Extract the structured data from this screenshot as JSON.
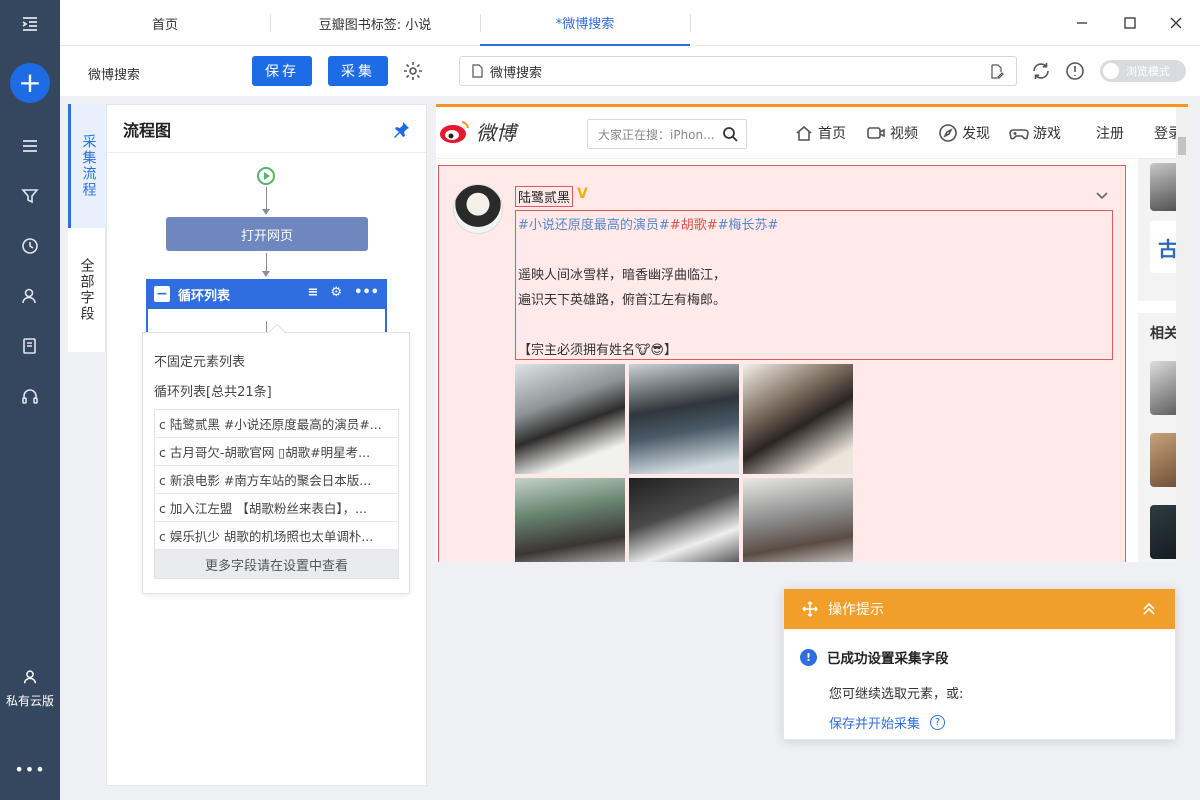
{
  "tabs": [
    {
      "label": "首页",
      "active": false
    },
    {
      "label": "豆瓣图书标签: 小说",
      "active": false
    },
    {
      "label": "*微博搜索",
      "active": true
    }
  ],
  "rail": {
    "cloud_label": "私有云版",
    "more_label": "•••"
  },
  "toolbar": {
    "title": "微博搜索",
    "save_label": "保存",
    "collect_label": "采集",
    "url_value": "微博搜索",
    "browse_mode_label": "浏览模式"
  },
  "side_tabs": {
    "collect_flow": "采集流程",
    "all_fields": "全部字段"
  },
  "flow": {
    "title": "流程图",
    "open_page_label": "打开网页",
    "loop_label": "循环列表",
    "tools": [
      "≡",
      "⚙",
      "•••"
    ]
  },
  "popover": {
    "type_label": "不固定元素列表",
    "count_label": "循环列表[总共21条]",
    "rows": [
      "c 陆鹭贰黑 #小说还原度最高的演员#...",
      "c 古月哥欠-胡歌官网 ▯胡歌#明星考...",
      "c 新浪电影 #南方车站的聚会日本版...",
      "c 加入江左盟 【胡歌粉丝来表白】，...",
      "c 娱乐扒少 胡歌的机场照也太单调朴..."
    ],
    "more_label": "更多字段请在设置中查看"
  },
  "weibo": {
    "logo_text": "微博",
    "search_placeholder": "大家正在搜：iPhon...",
    "nav": [
      "首页",
      "视频",
      "发现",
      "游戏",
      "注册",
      "登录"
    ],
    "post": {
      "author": "陆鹭贰黑",
      "topic_1": "#小说还原度最高的演员#",
      "topic_2": "#胡歌#",
      "topic_3": "#梅长苏#",
      "line_1": "遥映人间冰雪样，暗香幽浮曲临江，",
      "line_2": "遍识天下英雄路，俯首江左有梅郎。",
      "line_3": "【宗主必须拥有姓名🐮😎】"
    },
    "side_label": "相关"
  },
  "hint": {
    "title": "操作提示",
    "status": "已成功设置采集字段",
    "text": "您可继续选取元素，或:",
    "link": "保存并开始采集"
  },
  "colors": {
    "rail_bg": "#35475f",
    "primary": "#1e6be6",
    "accent_orange": "#f19f2a",
    "selection_red": "#e05a5a"
  }
}
